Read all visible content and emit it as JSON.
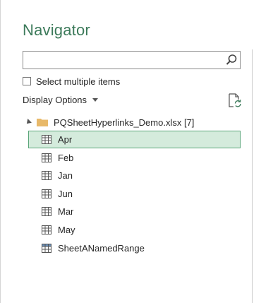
{
  "window": {
    "title": "Navigator"
  },
  "search": {
    "value": "",
    "placeholder": ""
  },
  "select_multiple": {
    "label": "Select multiple items",
    "checked": false
  },
  "display_options": {
    "label": "Display Options"
  },
  "tree": {
    "root_label": "PQSheetHyperlinks_Demo.xlsx [7]",
    "items": [
      {
        "label": "Apr",
        "icon": "sheet-icon",
        "selected": true
      },
      {
        "label": "Feb",
        "icon": "sheet-icon",
        "selected": false
      },
      {
        "label": "Jan",
        "icon": "sheet-icon",
        "selected": false
      },
      {
        "label": "Jun",
        "icon": "sheet-icon",
        "selected": false
      },
      {
        "label": "Mar",
        "icon": "sheet-icon",
        "selected": false
      },
      {
        "label": "May",
        "icon": "sheet-icon",
        "selected": false
      },
      {
        "label": "SheetANamedRange",
        "icon": "named-range-icon",
        "selected": false
      }
    ]
  },
  "colors": {
    "title": "#3c7a5a",
    "selection_bg": "#d4ebdc",
    "selection_border": "#5aa579",
    "folder": "#e8b96a"
  }
}
